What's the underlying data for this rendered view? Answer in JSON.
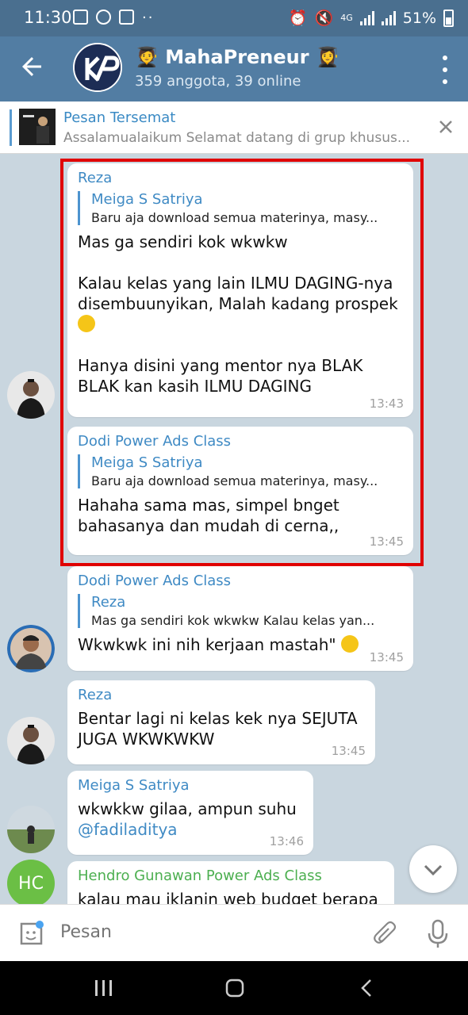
{
  "status_bar": {
    "time": "11:30",
    "network": "4G",
    "battery": "51%"
  },
  "header": {
    "title": "🧑‍🎓 MahaPreneur 👩‍🎓",
    "subtitle": "359 anggota, 39 online"
  },
  "pinned": {
    "title": "Pesan Tersemat",
    "text": "Assalamualaikum Selamat datang di grup khusus..."
  },
  "messages": [
    {
      "sender": "Reza",
      "reply_name": "Meiga S Satriya",
      "reply_text": "Baru aja download semua materinya, masy...",
      "text": "Mas ga sendiri kok wkwkw\n\nKalau kelas yang lain ILMU DAGING-nya disembuunyikan, Malah kadang prospek",
      "text2": "Hanya disini yang mentor nya BLAK BLAK kan kasih ILMU DAGING",
      "time": "13:43"
    },
    {
      "sender": "Dodi Power Ads Class",
      "reply_name": "Meiga S Satriya",
      "reply_text": "Baru aja download semua materinya, masy...",
      "text": "Hahaha sama mas, simpel bnget bahasanya dan mudah di cerna,,",
      "time": "13:45"
    },
    {
      "sender": "Dodi Power Ads Class",
      "reply_name": "Reza",
      "reply_text": "Mas ga sendiri kok wkwkw  Kalau kelas yan...",
      "text": "Wkwkwk ini nih kerjaan mastah\"",
      "time": "13:45"
    },
    {
      "sender": "Reza",
      "text": "Bentar lagi ni kelas kek nya SEJUTA JUGA WKWKWKW",
      "time": "13:45"
    },
    {
      "sender": "Meiga S Satriya",
      "text": "wkwkkw gilaa, ampun suhu",
      "mention": "@fadiladitya",
      "time": "13:46"
    },
    {
      "sender": "Hendro Gunawan Power Ads Class",
      "avatar_initials": "HC",
      "text": "kalau mau iklanin web budget berapa"
    }
  ],
  "input": {
    "placeholder": "Pesan"
  },
  "colors": {
    "appbar": "#527da3",
    "statusbar": "#4a6f8f",
    "highlight": "#e00000",
    "link": "#3f8ac4"
  }
}
